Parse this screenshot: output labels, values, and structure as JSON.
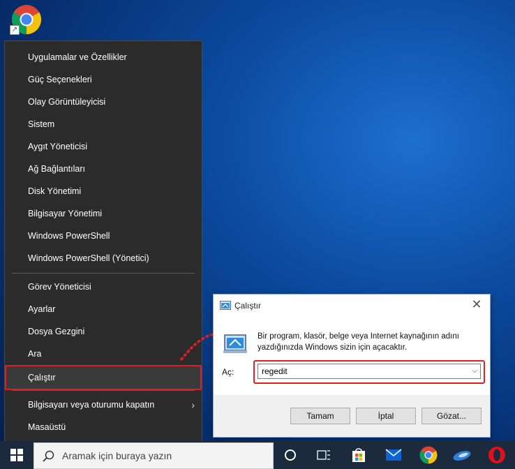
{
  "desktop": {
    "icons": [
      {
        "name": "chrome-shortcut"
      }
    ]
  },
  "winx_menu": {
    "items": [
      {
        "label": "Uygulamalar ve Özellikler"
      },
      {
        "label": "Güç Seçenekleri"
      },
      {
        "label": "Olay Görüntüleyicisi"
      },
      {
        "label": "Sistem"
      },
      {
        "label": "Aygıt Yöneticisi"
      },
      {
        "label": "Ağ Bağlantıları"
      },
      {
        "label": "Disk Yönetimi"
      },
      {
        "label": "Bilgisayar Yönetimi"
      },
      {
        "label": "Windows PowerShell"
      },
      {
        "label": "Windows PowerShell (Yönetici)"
      },
      {
        "label": "Görev Yöneticisi"
      },
      {
        "label": "Ayarlar"
      },
      {
        "label": "Dosya Gezgini"
      },
      {
        "label": "Ara"
      },
      {
        "label": "Çalıştır",
        "highlighted": true
      },
      {
        "label": "Bilgisayarı veya oturumu kapatın",
        "submenu": true
      },
      {
        "label": "Masaüstü"
      }
    ],
    "submenu_glyph": "›"
  },
  "run_dialog": {
    "title": "Çalıştır",
    "close_glyph": "✕",
    "description": "Bir program, klasör, belge veya Internet kaynağının adını yazdığınızda Windows sizin için açacaktır.",
    "open_label": "Aç:",
    "input_value": "regedit",
    "dropdown_glyph": "⌵",
    "buttons": {
      "ok": "Tamam",
      "cancel": "İptal",
      "browse": "Gözat..."
    }
  },
  "taskbar": {
    "search_placeholder": "Aramak için buraya yazın",
    "icons": [
      "windows-start-icon",
      "cortana-icon",
      "task-view-icon",
      "store-icon",
      "mail-icon",
      "chrome-icon",
      "edge-icon",
      "opera-icon"
    ]
  },
  "colors": {
    "highlight": "#e02020",
    "menu_bg": "#2b2b2b",
    "taskbar_bg": "#1b2a3c"
  }
}
